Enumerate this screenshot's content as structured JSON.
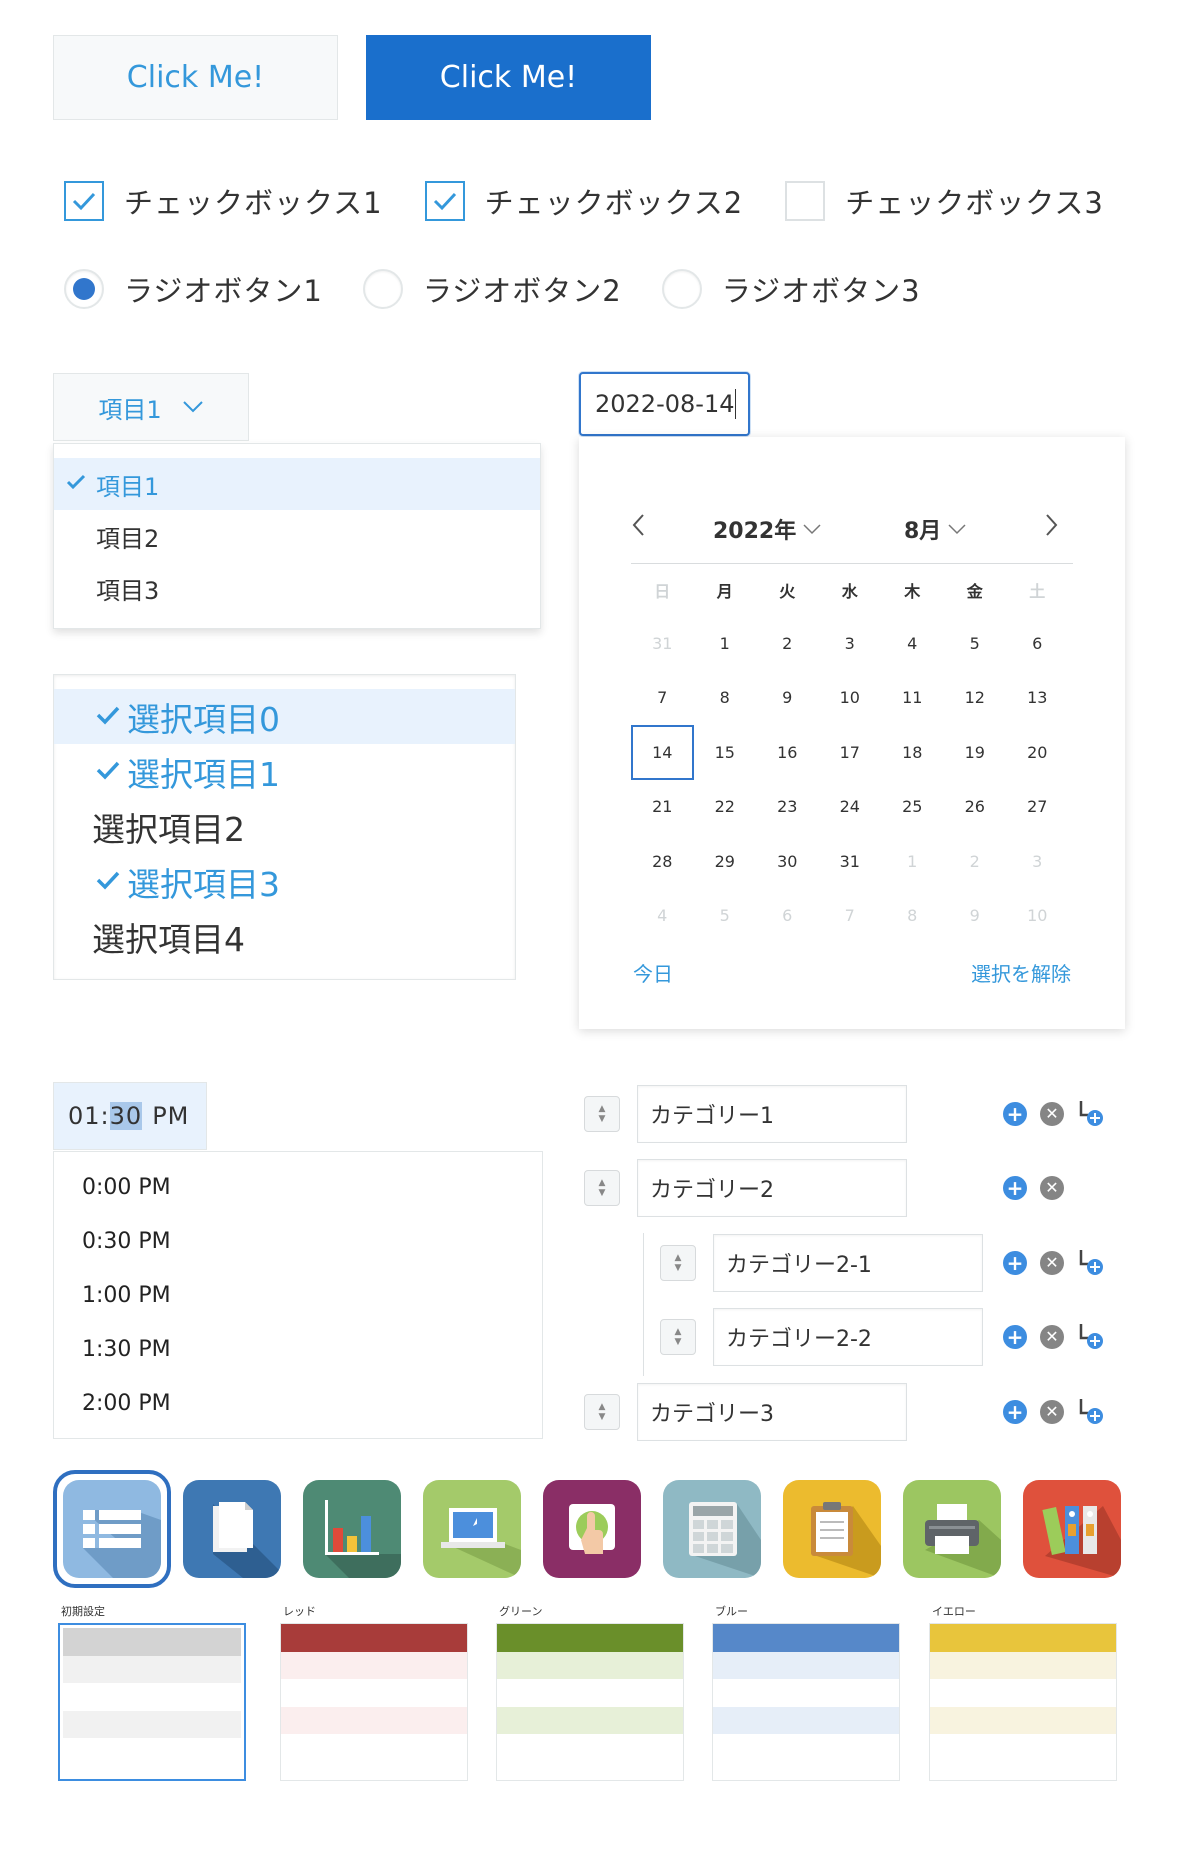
{
  "buttons": {
    "normal_label": "Click Me!",
    "primary_label": "Click Me!"
  },
  "checkboxes": [
    {
      "label": "チェックボックス1",
      "checked": true
    },
    {
      "label": "チェックボックス2",
      "checked": true
    },
    {
      "label": "チェックボックス3",
      "checked": false
    }
  ],
  "radios": [
    {
      "label": "ラジオボタン1",
      "checked": true
    },
    {
      "label": "ラジオボタン2",
      "checked": false
    },
    {
      "label": "ラジオボタン3",
      "checked": false
    }
  ],
  "dropdown": {
    "selected": "項目1",
    "options": [
      "項目1",
      "項目2",
      "項目3"
    ]
  },
  "multiselect": {
    "items": [
      {
        "label": "選択項目0",
        "selected": true
      },
      {
        "label": "選択項目1",
        "selected": true
      },
      {
        "label": "選択項目2",
        "selected": false
      },
      {
        "label": "選択項目3",
        "selected": true
      },
      {
        "label": "選択項目4",
        "selected": false
      }
    ]
  },
  "datepicker": {
    "value": "2022-08-14",
    "year_label": "2022年",
    "month_label": "8月",
    "weekdays": [
      "日",
      "月",
      "火",
      "水",
      "木",
      "金",
      "土"
    ],
    "days": [
      "31",
      "1",
      "2",
      "3",
      "4",
      "5",
      "6",
      "7",
      "8",
      "9",
      "10",
      "11",
      "12",
      "13",
      "14",
      "15",
      "16",
      "17",
      "18",
      "19",
      "20",
      "21",
      "22",
      "23",
      "24",
      "25",
      "26",
      "27",
      "28",
      "29",
      "30",
      "31",
      "1",
      "2",
      "3",
      "4",
      "5",
      "6",
      "7",
      "8",
      "9",
      "10"
    ],
    "today_label": "今日",
    "clear_label": "選択を解除"
  },
  "timepicker": {
    "value_hour": "01",
    "value_colon": ":",
    "value_minute": "30",
    "value_ampm": "PM",
    "options": [
      "0:00 PM",
      "0:30 PM",
      "1:00 PM",
      "1:30 PM",
      "2:00 PM"
    ]
  },
  "categories": {
    "items": [
      {
        "label": "カテゴリー1",
        "level": 0,
        "has_child_button": true
      },
      {
        "label": "カテゴリー2",
        "level": 0,
        "has_child_button": false
      },
      {
        "label": "カテゴリー2-1",
        "level": 1,
        "has_child_button": true
      },
      {
        "label": "カテゴリー2-2",
        "level": 1,
        "has_child_button": true
      },
      {
        "label": "カテゴリー3",
        "level": 0,
        "has_child_button": true
      }
    ]
  },
  "icons": [
    {
      "name": "list-icon",
      "bg": "#8fb9e1",
      "selected": true
    },
    {
      "name": "document-icon",
      "bg": "#3e78b3"
    },
    {
      "name": "bar-chart-icon",
      "bg": "#4e8a74"
    },
    {
      "name": "laptop-icon",
      "bg": "#a4ca6a"
    },
    {
      "name": "touch-hand-icon",
      "bg": "#8a2e66"
    },
    {
      "name": "calculator-icon",
      "bg": "#8fb9c4"
    },
    {
      "name": "clipboard-icon",
      "bg": "#ecbb2e"
    },
    {
      "name": "printer-icon",
      "bg": "#9cc661"
    },
    {
      "name": "binders-icon",
      "bg": "#df513c"
    }
  ],
  "table_themes": [
    {
      "label": "初期設定",
      "header": "#d3d3d3",
      "stripe": "#f1f1f1",
      "selected": true
    },
    {
      "label": "レッド",
      "header": "#a83c3a",
      "stripe": "#fbeeee"
    },
    {
      "label": "グリーン",
      "header": "#6a8f2a",
      "stripe": "#e7f0d8"
    },
    {
      "label": "ブルー",
      "header": "#5688c9",
      "stripe": "#e6eef8"
    },
    {
      "label": "イエロー",
      "header": "#e8c53c",
      "stripe": "#f8f3df"
    }
  ],
  "colors": {
    "accent": "#3498db",
    "primary": "#1a6fcc",
    "selection_bg": "#e8f2fd"
  }
}
